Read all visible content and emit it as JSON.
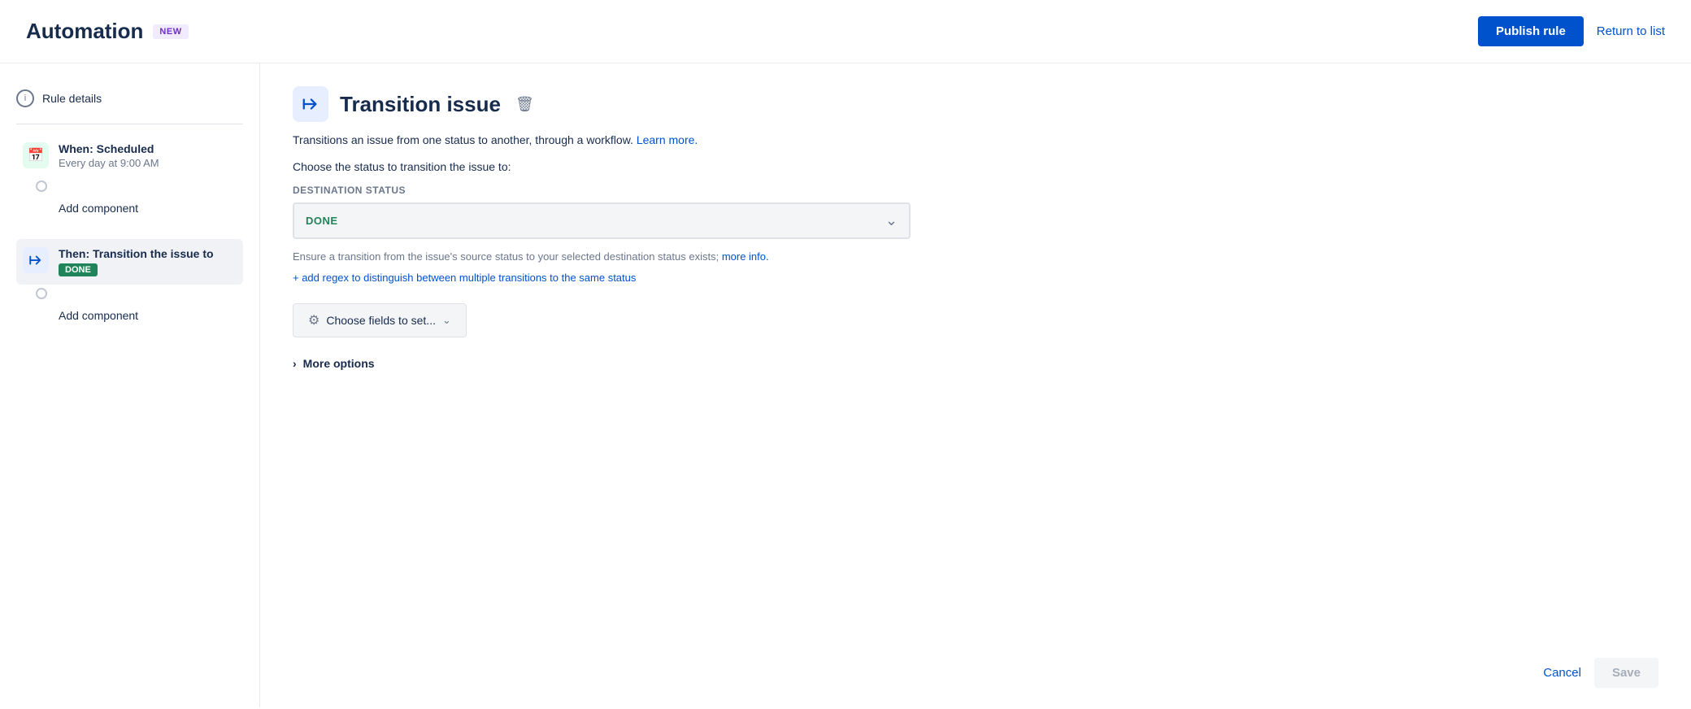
{
  "header": {
    "title": "Automation",
    "badge": "NEW",
    "publish_label": "Publish rule",
    "return_label": "Return to list"
  },
  "sidebar": {
    "rule_details_label": "Rule details",
    "when_title": "When: Scheduled",
    "when_subtitle": "Every day at 9:00 AM",
    "add_component_1": "Add component",
    "then_title": "Then: Transition the issue to",
    "then_done": "DONE",
    "add_component_2": "Add component"
  },
  "panel": {
    "title": "Transition issue",
    "description_start": "Transitions an issue from one status to another, through a workflow.",
    "learn_more": "Learn more.",
    "choose_status_text": "Choose the status to transition the issue to:",
    "destination_label": "Destination status",
    "selected_status": "DONE",
    "ensure_text_start": "Ensure a transition from the issue's source status to your selected destination status exists;",
    "more_info": "more info.",
    "regex_link": "+ add regex to distinguish between multiple transitions to the same status",
    "choose_fields_label": "Choose fields to set...",
    "more_options_label": "More options",
    "cancel_label": "Cancel",
    "save_label": "Save"
  }
}
